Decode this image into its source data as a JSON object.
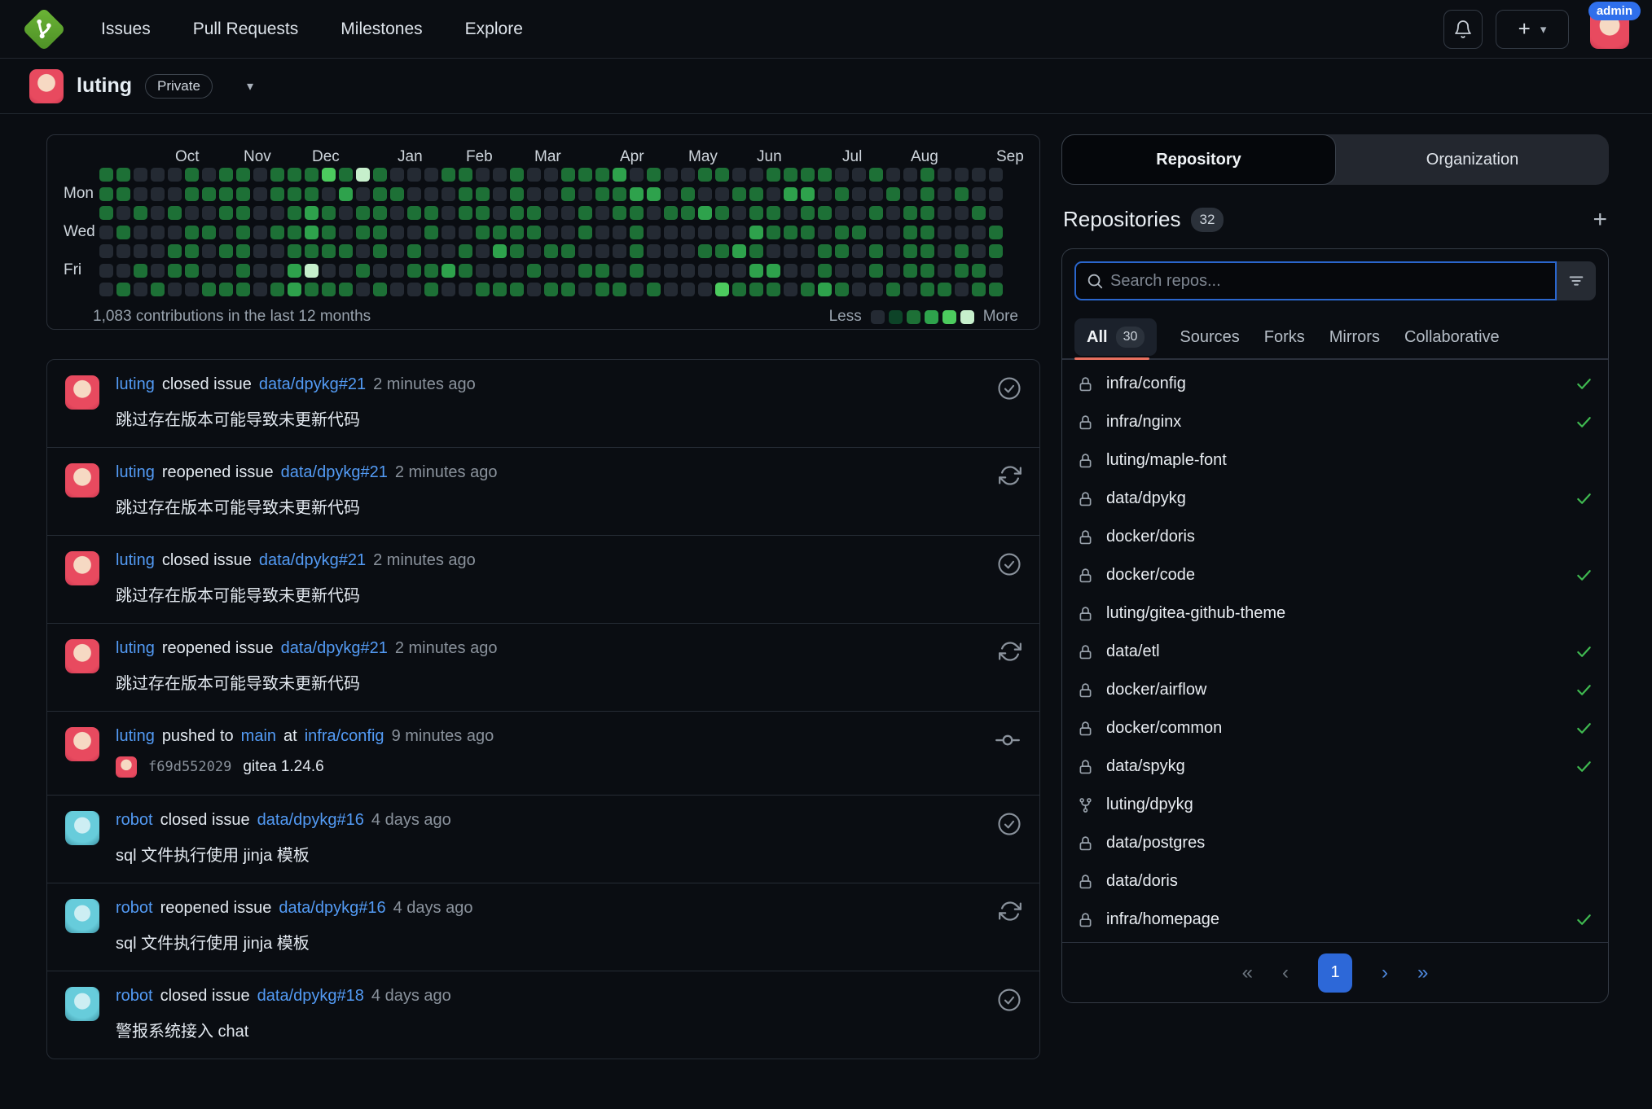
{
  "navbar": {
    "links": [
      "Issues",
      "Pull Requests",
      "Milestones",
      "Explore"
    ],
    "new_button_label": "+",
    "caret": "▾",
    "admin_badge": "admin"
  },
  "profile": {
    "username": "luting",
    "visibility_badge": "Private",
    "caret": "▾"
  },
  "heatmap": {
    "months": [
      [
        "Oct",
        4
      ],
      [
        "Nov",
        8
      ],
      [
        "Dec",
        12
      ],
      [
        "Jan",
        17
      ],
      [
        "Feb",
        21
      ],
      [
        "Mar",
        25
      ],
      [
        "Apr",
        30
      ],
      [
        "May",
        34
      ],
      [
        "Jun",
        38
      ],
      [
        "Jul",
        43
      ],
      [
        "Aug",
        47
      ],
      [
        "Sep",
        52
      ]
    ],
    "day_labels": {
      "1": "Mon",
      "3": "Wed",
      "5": "Fri"
    },
    "rows": [
      "22000202202224252000220020022230200220022220020020000",
      "22000222202220302200022020020223302002203302002020200",
      "20202002200232022022022022002022022320220220020220020",
      "02000220202232022002002222002002000000322202200220002",
      "00002202200222202020020320220002000223200022020220202",
      "00202200200350020022320002002202000000330020020220220",
      "02020022202322202002002220220220200042220232002022022"
    ],
    "colors": [
      "#242a33",
      "#0d4328",
      "#1d7036",
      "#2ea24c",
      "#4ccb5e",
      "#c6efcc"
    ],
    "total_label": "1,083 contributions in the last 12 months",
    "legend_less": "Less",
    "legend_more": "More"
  },
  "feed": [
    {
      "avatar": "luting",
      "user": "luting",
      "action": "closed issue",
      "target": "data/dpykg#21",
      "time": "2 minutes ago",
      "body": "跳过存在版本可能导致未更新代码",
      "icon": "closed"
    },
    {
      "avatar": "luting",
      "user": "luting",
      "action": "reopened issue",
      "target": "data/dpykg#21",
      "time": "2 minutes ago",
      "body": "跳过存在版本可能导致未更新代码",
      "icon": "reopened"
    },
    {
      "avatar": "luting",
      "user": "luting",
      "action": "closed issue",
      "target": "data/dpykg#21",
      "time": "2 minutes ago",
      "body": "跳过存在版本可能导致未更新代码",
      "icon": "closed"
    },
    {
      "avatar": "luting",
      "user": "luting",
      "action": "reopened issue",
      "target": "data/dpykg#21",
      "time": "2 minutes ago",
      "body": "跳过存在版本可能导致未更新代码",
      "icon": "reopened"
    },
    {
      "avatar": "luting",
      "user": "luting",
      "action": "pushed to",
      "branch": "main",
      "conjunction": "at",
      "target": "infra/config",
      "time": "9 minutes ago",
      "commit_sha": "f69d552029",
      "commit_msg": "gitea 1.24.6",
      "icon": "commit"
    },
    {
      "avatar": "robot",
      "user": "robot",
      "action": "closed issue",
      "target": "data/dpykg#16",
      "time": "4 days ago",
      "body": "sql 文件执行使用 jinja 模板",
      "icon": "closed"
    },
    {
      "avatar": "robot",
      "user": "robot",
      "action": "reopened issue",
      "target": "data/dpykg#16",
      "time": "4 days ago",
      "body": "sql 文件执行使用 jinja 模板",
      "icon": "reopened"
    },
    {
      "avatar": "robot",
      "user": "robot",
      "action": "closed issue",
      "target": "data/dpykg#18",
      "time": "4 days ago",
      "body": "警报系统接入 chat",
      "icon": "closed"
    }
  ],
  "sidebar": {
    "tabs": [
      {
        "label": "Repository",
        "active": true
      },
      {
        "label": "Organization",
        "active": false
      }
    ],
    "heading": "Repositories",
    "count": "32",
    "add_label": "+",
    "search_placeholder": "Search repos...",
    "filters": [
      {
        "label": "All",
        "count": "30",
        "active": true
      },
      {
        "label": "Sources"
      },
      {
        "label": "Forks"
      },
      {
        "label": "Mirrors"
      },
      {
        "label": "Collaborative"
      }
    ],
    "repos": [
      {
        "name": "infra/config",
        "icon": "lock",
        "synced": true
      },
      {
        "name": "infra/nginx",
        "icon": "lock",
        "synced": true
      },
      {
        "name": "luting/maple-font",
        "icon": "lock",
        "synced": false
      },
      {
        "name": "data/dpykg",
        "icon": "lock",
        "synced": true
      },
      {
        "name": "docker/doris",
        "icon": "lock",
        "synced": false
      },
      {
        "name": "docker/code",
        "icon": "lock",
        "synced": true
      },
      {
        "name": "luting/gitea-github-theme",
        "icon": "lock",
        "synced": false
      },
      {
        "name": "data/etl",
        "icon": "lock",
        "synced": true
      },
      {
        "name": "docker/airflow",
        "icon": "lock",
        "synced": true
      },
      {
        "name": "docker/common",
        "icon": "lock",
        "synced": true
      },
      {
        "name": "data/spykg",
        "icon": "lock",
        "synced": true
      },
      {
        "name": "luting/dpykg",
        "icon": "fork",
        "synced": false
      },
      {
        "name": "data/postgres",
        "icon": "lock",
        "synced": false
      },
      {
        "name": "data/doris",
        "icon": "lock",
        "synced": false
      },
      {
        "name": "infra/homepage",
        "icon": "lock",
        "synced": true
      }
    ],
    "pagination": {
      "first": "«",
      "prev": "‹",
      "current": "1",
      "next": "›",
      "last": "»"
    }
  }
}
